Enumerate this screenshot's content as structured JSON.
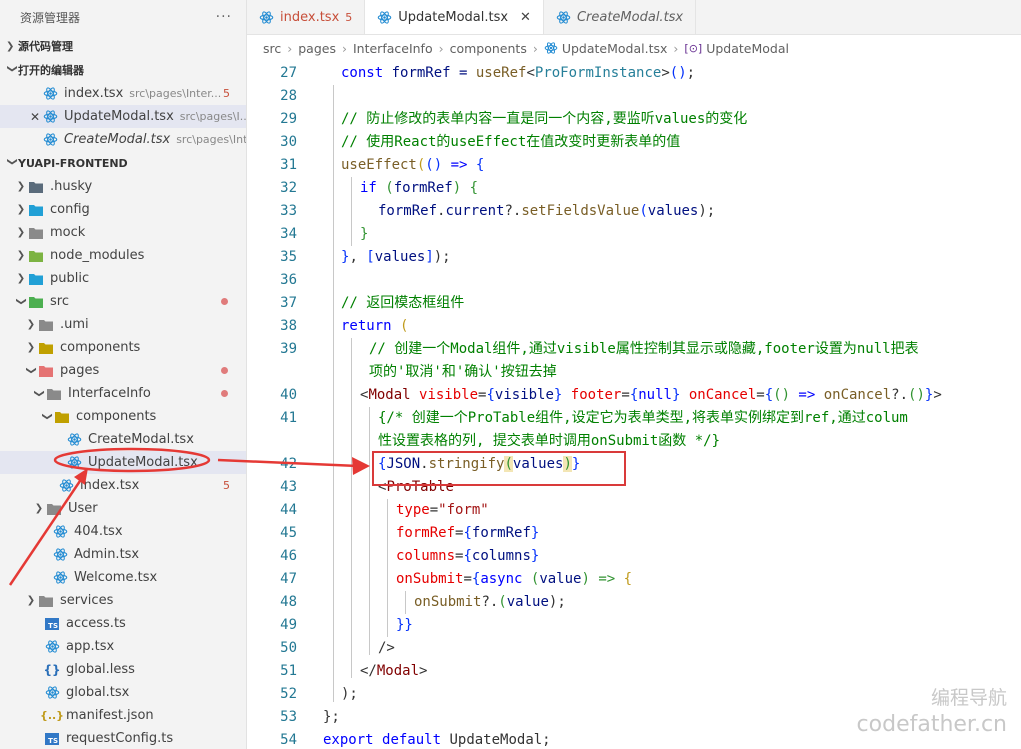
{
  "sidebar": {
    "title": "资源管理器",
    "more": "···",
    "sections": {
      "source_control": "源代码管理",
      "open_editors": "打开的编辑器",
      "project": "YUAPI-FRONTEND"
    },
    "open_editors": [
      {
        "name": "index.tsx",
        "path": "src\\pages\\Inter...",
        "badge": "5"
      },
      {
        "name": "UpdateModal.tsx",
        "path": "src\\pages\\I...",
        "close": "✕"
      },
      {
        "name": "CreateModal.tsx",
        "path": "src\\pages\\Int..."
      }
    ],
    "tree": [
      {
        "label": ".husky"
      },
      {
        "label": "config"
      },
      {
        "label": "mock"
      },
      {
        "label": "node_modules"
      },
      {
        "label": "public"
      },
      {
        "label": "src"
      },
      {
        "label": ".umi"
      },
      {
        "label": "components"
      },
      {
        "label": "pages"
      },
      {
        "label": "InterfaceInfo"
      },
      {
        "label": "components"
      },
      {
        "label": "CreateModal.tsx"
      },
      {
        "label": "UpdateModal.tsx"
      },
      {
        "label": "index.tsx",
        "badge": "5"
      },
      {
        "label": "User"
      },
      {
        "label": "404.tsx"
      },
      {
        "label": "Admin.tsx"
      },
      {
        "label": "Welcome.tsx"
      },
      {
        "label": "services"
      },
      {
        "label": "access.ts"
      },
      {
        "label": "app.tsx"
      },
      {
        "label": "global.less"
      },
      {
        "label": "global.tsx"
      },
      {
        "label": "manifest.json"
      },
      {
        "label": "requestConfig.ts"
      }
    ]
  },
  "tabs": [
    {
      "label": "index.tsx",
      "modified": "5"
    },
    {
      "label": "UpdateModal.tsx",
      "close": "✕"
    },
    {
      "label": "CreateModal.tsx"
    }
  ],
  "breadcrumb": [
    "src",
    "pages",
    "InterfaceInfo",
    "components",
    "UpdateModal.tsx",
    "UpdateModal"
  ],
  "editor": {
    "line_numbers": [
      "27",
      "28",
      "29",
      "30",
      "31",
      "32",
      "33",
      "34",
      "35",
      "36",
      "37",
      "38",
      "39",
      "40",
      "41",
      "42",
      "43",
      "44",
      "45",
      "46",
      "47",
      "48",
      "49",
      "50",
      "51",
      "52",
      "53",
      "54"
    ],
    "code": {
      "l27": [
        "const",
        " formRef = ",
        "useRef",
        "<",
        "ProFormInstance",
        ">",
        "()",
        ";"
      ],
      "l29": "// 防止修改的表单内容一直是同一个内容,要监听values的变化",
      "l30": "// 使用React的useEffect在值改变时更新表单的值",
      "l31": [
        "useEffect",
        "(",
        "()",
        " => ",
        "{"
      ],
      "l32": [
        "if",
        " (",
        "formRef",
        ") ",
        "{"
      ],
      "l33": [
        "formRef",
        ".",
        "current",
        "?.",
        "setFieldsValue",
        "(",
        "values",
        ");"
      ],
      "l34": "}",
      "l35": [
        "}",
        ", ",
        "[",
        "values",
        "]",
        ");"
      ],
      "l37": "// 返回模态框组件",
      "l38": [
        "return",
        " ("
      ],
      "l39a": "// 创建一个Modal组件,通过visible属性控制其显示或隐藏,footer设置为null把表",
      "l39b": "项的'取消'和'确认'按钮去掉",
      "l40": [
        "<",
        "Modal",
        " visible",
        "=",
        "{",
        "visible",
        "}",
        " footer",
        "=",
        "{",
        "null",
        "}",
        " onCancel",
        "=",
        "{",
        "()",
        " => ",
        "onCancel",
        "?.",
        "()",
        "}",
        ">"
      ],
      "l41a": "{/* 创建一个ProTable组件,设定它为表单类型,将表单实例绑定到ref,通过colum",
      "l41b": "性设置表格的列, 提交表单时调用onSubmit函数 */}",
      "l42": [
        "{",
        "JSON",
        ".",
        "stringify",
        "(",
        "values",
        ")",
        "}"
      ],
      "l43": [
        "<",
        "ProTable"
      ],
      "l44": [
        "type",
        "=",
        "\"form\""
      ],
      "l45": [
        "formRef",
        "=",
        "{",
        "formRef",
        "}"
      ],
      "l46": [
        "columns",
        "=",
        "{",
        "columns",
        "}"
      ],
      "l47": [
        "onSubmit",
        "=",
        "{",
        "async",
        " (",
        "value",
        ") => ",
        "{"
      ],
      "l48": [
        "onSubmit",
        "?.",
        "(",
        "value",
        ");"
      ],
      "l49": "}}",
      "l50": "/>",
      "l51": [
        "</",
        "Modal",
        ">"
      ],
      "l52": ");",
      "l53": "};",
      "l54": [
        "export",
        " ",
        "default",
        " UpdateModal;"
      ]
    }
  },
  "watermark": {
    "line1": "编程导航",
    "line2": "codefather.cn"
  },
  "colors": {
    "annotation_red": "#d93a3a",
    "react_icon": "#1f8ad2",
    "keyword": "#0000ff"
  }
}
